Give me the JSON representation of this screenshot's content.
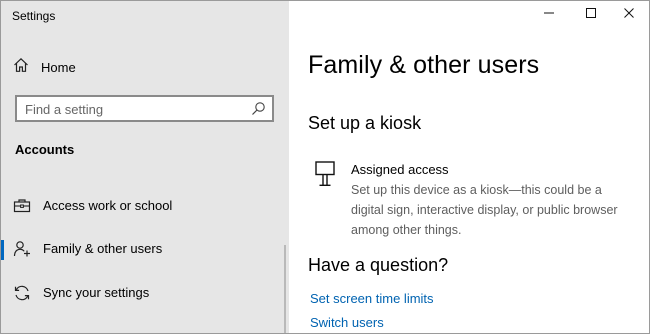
{
  "window": {
    "title": "Settings",
    "controls": {
      "minimize": "minimize-icon",
      "maximize": "maximize-icon",
      "close": "close-icon"
    }
  },
  "sidebar": {
    "home": {
      "label": "Home",
      "icon": "home-icon"
    },
    "search": {
      "placeholder": "Find a setting",
      "icon": "search-icon"
    },
    "section_heading": "Accounts",
    "items": [
      {
        "label": "Access work or school",
        "icon": "briefcase-icon",
        "selected": false
      },
      {
        "label": "Family & other users",
        "icon": "person-add-icon",
        "selected": true
      },
      {
        "label": "Sync your settings",
        "icon": "sync-icon",
        "selected": false
      }
    ]
  },
  "main": {
    "page_title": "Family & other users",
    "kiosk": {
      "heading": "Set up a kiosk",
      "item_title": "Assigned access",
      "item_description": "Set up this device as a kiosk—this could be a digital sign, interactive display, or public browser among other things.",
      "icon": "kiosk-monitor-icon"
    },
    "question": {
      "heading": "Have a question?",
      "links": [
        "Set screen time limits",
        "Switch users"
      ]
    }
  },
  "colors": {
    "sidebar_bg": "#e6e6e6",
    "accent": "#0067c0",
    "link": "#0063b1",
    "muted_text": "#5e5e5e"
  }
}
